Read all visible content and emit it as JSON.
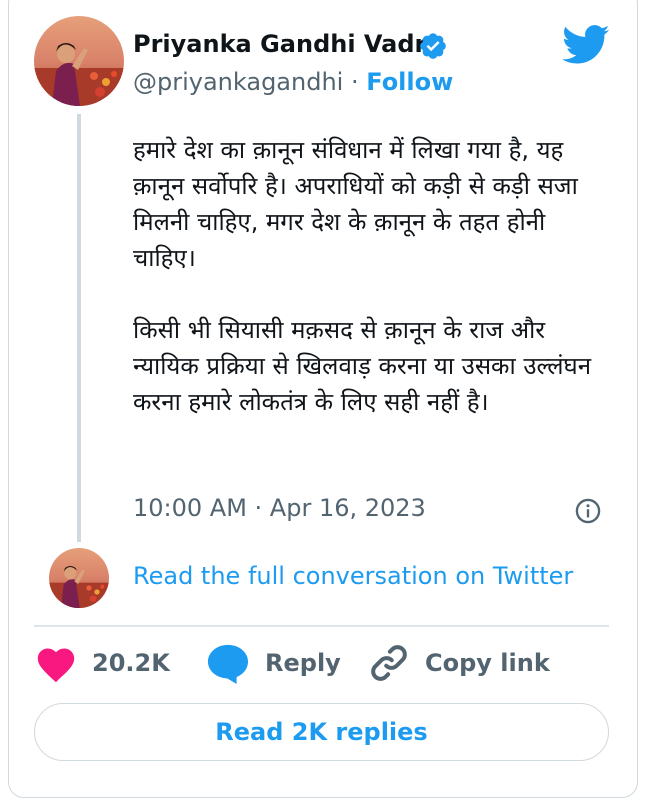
{
  "author": {
    "name": "Priyanka Gandhi Vadra",
    "handle": "@priyankagandhi",
    "separator": "·",
    "follow_label": "Follow",
    "verified": true
  },
  "tweet": {
    "paragraphs": [
      "हमारे देश का क़ानून संविधान में लिखा गया है, यह क़ानून सर्वोपरि है। अपराधियों को कड़ी से कड़ी सजा मिलनी चाहिए, मगर देश के क़ानून के तहत होनी चाहिए।",
      "किसी भी सियासी मक़सद से क़ानून के राज और न्यायिक प्रक्रिया से खिलवाड़ करना या उसका उल्लंघन करना हमारे लोकतंत्र के लिए सही नहीं है।"
    ],
    "timestamp": "10:00 AM · Apr 16, 2023"
  },
  "conversation": {
    "link_label": "Read the full conversation on Twitter"
  },
  "actions": {
    "likes": "20.2K",
    "reply_label": "Reply",
    "copy_link_label": "Copy link"
  },
  "replies_button": {
    "label": "Read 2K replies"
  },
  "colors": {
    "twitter_blue": "#1d9bf0",
    "like_pink": "#f91880",
    "text_primary": "#0f1419",
    "text_secondary": "#536471",
    "border": "#cfd9de"
  },
  "icons": {
    "logo": "twitter-bird-icon",
    "verified": "verified-badge-icon",
    "info": "info-icon",
    "like": "heart-icon",
    "reply": "speech-bubble-icon",
    "copy_link": "link-icon"
  }
}
